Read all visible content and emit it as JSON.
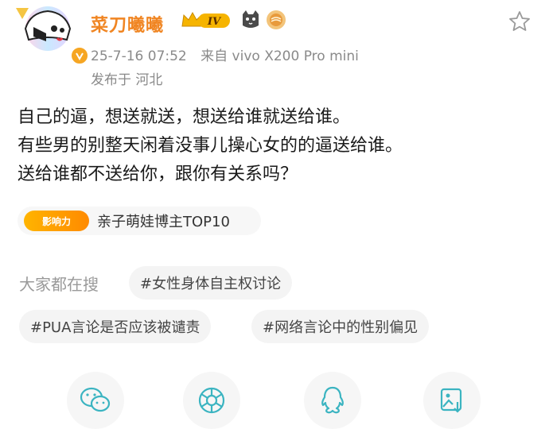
{
  "post": {
    "username": "菜刀曦曦",
    "level_badge": "IV",
    "timestamp": "25-7-16 07:52",
    "source": "来自 vivo X200 Pro mini",
    "location": "发布于 河北",
    "lines": [
      "自己的逼，想送就送，想送给谁就送给谁。",
      "有些男的别整天闲着没事儿操心女的的逼送给谁。",
      "送给谁都不送给你，跟你有关系吗？"
    ]
  },
  "influence": {
    "logo_text": "影响力",
    "label": "亲子萌娃博主TOP10"
  },
  "searches": {
    "label": "大家都在搜",
    "tags": [
      "#女性身体自主权讨论",
      "#PUA言论是否应该被谴责",
      "#网络言论中的性别偏见"
    ]
  },
  "share_icons": [
    "wechat-icon",
    "moments-icon",
    "qq-icon",
    "save-image-icon"
  ],
  "colors": {
    "username": "#f08522",
    "verified_badge": "#f6a623",
    "share_icon": "#3bb4c1"
  }
}
